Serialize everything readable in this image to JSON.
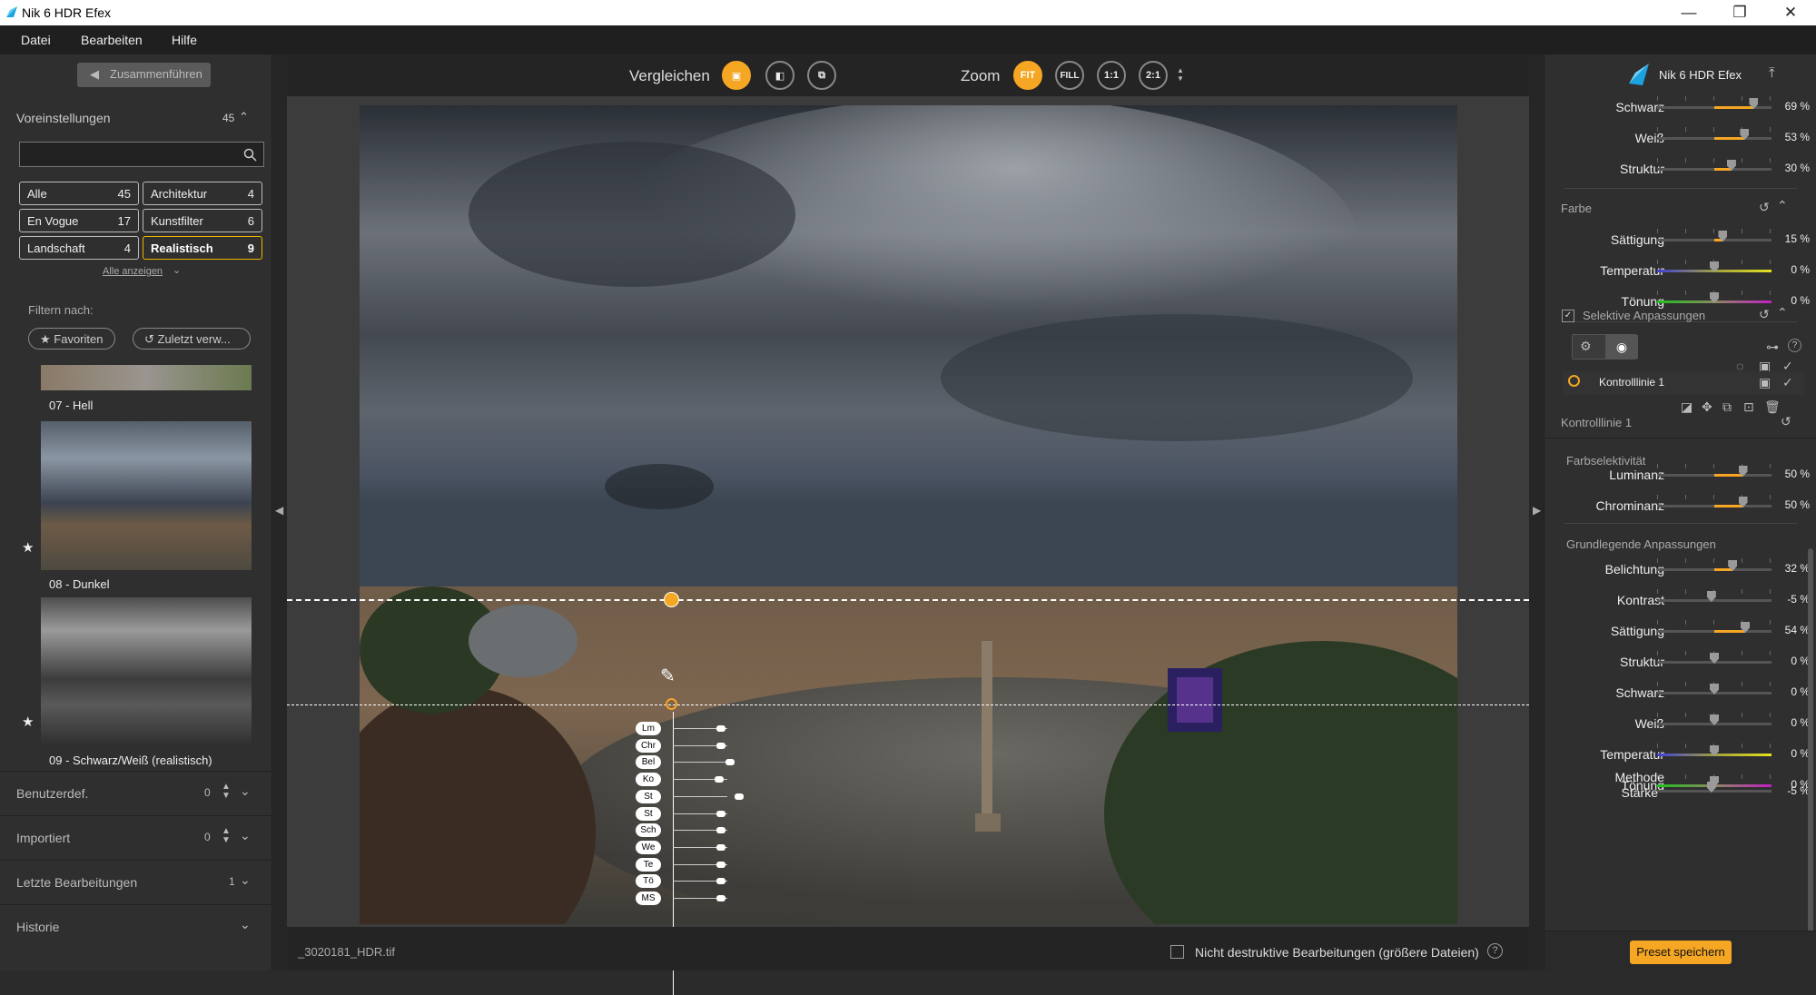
{
  "window": {
    "title": "Nik 6 HDR Efex",
    "minimize": "—",
    "maximize": "❐",
    "close": "✕"
  },
  "menu": [
    "Datei",
    "Bearbeiten",
    "Hilfe"
  ],
  "left": {
    "merge_label": "Zusammenführen",
    "presets_label": "Voreinstellungen",
    "presets_count": "45",
    "search_placeholder": "",
    "categories": [
      {
        "label": "Alle",
        "count": "45"
      },
      {
        "label": "Architektur",
        "count": "4"
      },
      {
        "label": "En Vogue",
        "count": "17"
      },
      {
        "label": "Kunstfilter",
        "count": "6"
      },
      {
        "label": "Landschaft",
        "count": "4"
      },
      {
        "label": "Realistisch",
        "count": "9"
      }
    ],
    "show_all": "Alle anzeigen",
    "filter_label": "Filtern nach:",
    "favorites": "Favoriten",
    "recent": "Zuletzt verw...",
    "thumbs": [
      {
        "label": "07 - Hell"
      },
      {
        "label": "08 - Dunkel"
      },
      {
        "label": "09 - Schwarz/Weiß (realistisch)"
      }
    ],
    "sections": [
      {
        "label": "Benutzerdef.",
        "count": "0"
      },
      {
        "label": "Importiert",
        "count": "0"
      },
      {
        "label": "Letzte Bearbeitungen",
        "count": "1"
      },
      {
        "label": "Historie",
        "count": ""
      }
    ]
  },
  "top": {
    "compare_label": "Vergleichen",
    "zoom_label": "Zoom",
    "zoom": [
      "FIT",
      "FILL",
      "1:1",
      "2:1"
    ]
  },
  "control_points": [
    "Lm",
    "Chr",
    "Bel",
    "Ko",
    "St",
    "St",
    "Sch",
    "We",
    "Te",
    "Tö",
    "MS"
  ],
  "bottom": {
    "filename": "_3020181_HDR.tif",
    "nondestructive": "Nicht destruktive Bearbeitungen (größere Dateien)",
    "help": "?"
  },
  "right": {
    "title": "Nik 6 HDR Efex",
    "tone_sliders": [
      {
        "label": "Schwarz",
        "value": "69 %",
        "pct": 0.69
      },
      {
        "label": "Weiß",
        "value": "53 %",
        "pct": 0.53
      },
      {
        "label": "Struktur",
        "value": "30 %",
        "pct": 0.3
      }
    ],
    "farbe_label": "Farbe",
    "farbe_sliders": [
      {
        "label": "Sättigung",
        "value": "15 %",
        "pct": 0.15
      },
      {
        "label": "Temperatur",
        "value": "0 %",
        "pct": 0
      },
      {
        "label": "Tönung",
        "value": "0 %",
        "pct": 0
      }
    ],
    "selective_label": "Selektive Anpassungen",
    "control_line_item": "Kontrolllinie 1",
    "control_line_header": "Kontrolllinie 1",
    "color_selectivity_label": "Farbselektivität",
    "cs_sliders": [
      {
        "label": "Luminanz",
        "value": "50 %",
        "pct": 0.5
      },
      {
        "label": "Chrominanz",
        "value": "50 %",
        "pct": 0.5
      }
    ],
    "basic_label": "Grundlegende Anpassungen",
    "basic_sliders": [
      {
        "label": "Belichtung",
        "value": "32 %",
        "pct": 0.32
      },
      {
        "label": "Kontrast",
        "value": "-5 %",
        "pct": -0.05
      },
      {
        "label": "Sättigung",
        "value": "54 %",
        "pct": 0.54
      },
      {
        "label": "Struktur",
        "value": "0 %",
        "pct": 0
      },
      {
        "label": "Schwarz",
        "value": "0 %",
        "pct": 0
      },
      {
        "label": "Weiß",
        "value": "0 %",
        "pct": 0
      },
      {
        "label": "Temperatur",
        "value": "0 %",
        "pct": 0
      },
      {
        "label": "Tönung",
        "value": "0 %",
        "pct": 0
      }
    ],
    "method_label_1": "Methode",
    "method_label_2": "Stärke",
    "method_value": "-5 %",
    "method_pct": -0.05,
    "save_preset": "Preset speichern"
  },
  "colors": {
    "accent": "#f5a623",
    "selected_border": "#f0b400",
    "temp_gradient": "#3f3fd6",
    "tint_gradient": "#1ec01e"
  }
}
